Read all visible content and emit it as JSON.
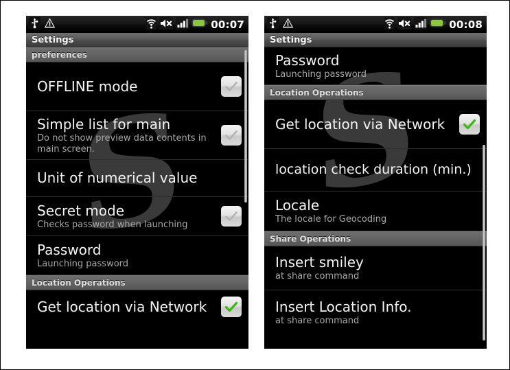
{
  "app": {
    "title": "Settings"
  },
  "panels": [
    {
      "id": "left",
      "statusbar": {
        "left_icons": [
          "usb-icon",
          "warning-icon"
        ],
        "right_icons": [
          "wifi-icon",
          "volume-mute-icon",
          "cellular-signal-icon",
          "battery-icon"
        ],
        "clock": "00:07"
      },
      "title": "Settings",
      "watermark": "S",
      "rows": [
        {
          "type": "header",
          "label": "preferences"
        },
        {
          "type": "item",
          "title": "OFFLINE mode",
          "subtitle": "",
          "checkbox": "unchecked"
        },
        {
          "type": "item",
          "title": "Simple list for main",
          "subtitle": "Do not show preview data contents in main screen.",
          "checkbox": "unchecked"
        },
        {
          "type": "item",
          "title": "Unit of numerical value",
          "subtitle": "",
          "checkbox": "none"
        },
        {
          "type": "item",
          "title": "Secret mode",
          "subtitle": "Checks password when launching",
          "checkbox": "unchecked"
        },
        {
          "type": "item",
          "title": "Password",
          "subtitle": "Launching password",
          "checkbox": "none"
        },
        {
          "type": "header",
          "label": "Location Operations"
        },
        {
          "type": "item",
          "title": "Get location via Network",
          "subtitle": "",
          "checkbox": "checked"
        }
      ]
    },
    {
      "id": "right",
      "statusbar": {
        "left_icons": [
          "usb-icon",
          "warning-icon"
        ],
        "right_icons": [
          "wifi-icon",
          "volume-mute-icon",
          "cellular-signal-icon",
          "battery-icon"
        ],
        "clock": "00:08"
      },
      "title": "Settings",
      "watermark": "S",
      "rows": [
        {
          "type": "item",
          "title": "Password",
          "subtitle": "Launching password",
          "checkbox": "none"
        },
        {
          "type": "header",
          "label": "Location Operations"
        },
        {
          "type": "item",
          "title": "Get location via Network",
          "subtitle": "",
          "checkbox": "checked"
        },
        {
          "type": "item",
          "title": "location check duration (min.)",
          "subtitle": "",
          "checkbox": "none"
        },
        {
          "type": "item",
          "title": "Locale",
          "subtitle": "The locale for Geocoding",
          "checkbox": "none"
        },
        {
          "type": "header",
          "label": "Share Operations"
        },
        {
          "type": "item",
          "title": "Insert smiley",
          "subtitle": "at share command",
          "checkbox": "none"
        },
        {
          "type": "item",
          "title": "Insert Location Info.",
          "subtitle": "at share command",
          "checkbox": "none"
        }
      ]
    }
  ],
  "colors": {
    "screen_background": "#000000",
    "page_background": "#ffffff",
    "title_text": "#f2f2f2",
    "row_title_text": "#f4f4f4",
    "row_subtitle_text": "#a9a9a9",
    "section_header_text": "#dedede",
    "check_green": "#3cb518",
    "check_gray": "#b3b3b3",
    "battery_green": "#8cc63f"
  }
}
